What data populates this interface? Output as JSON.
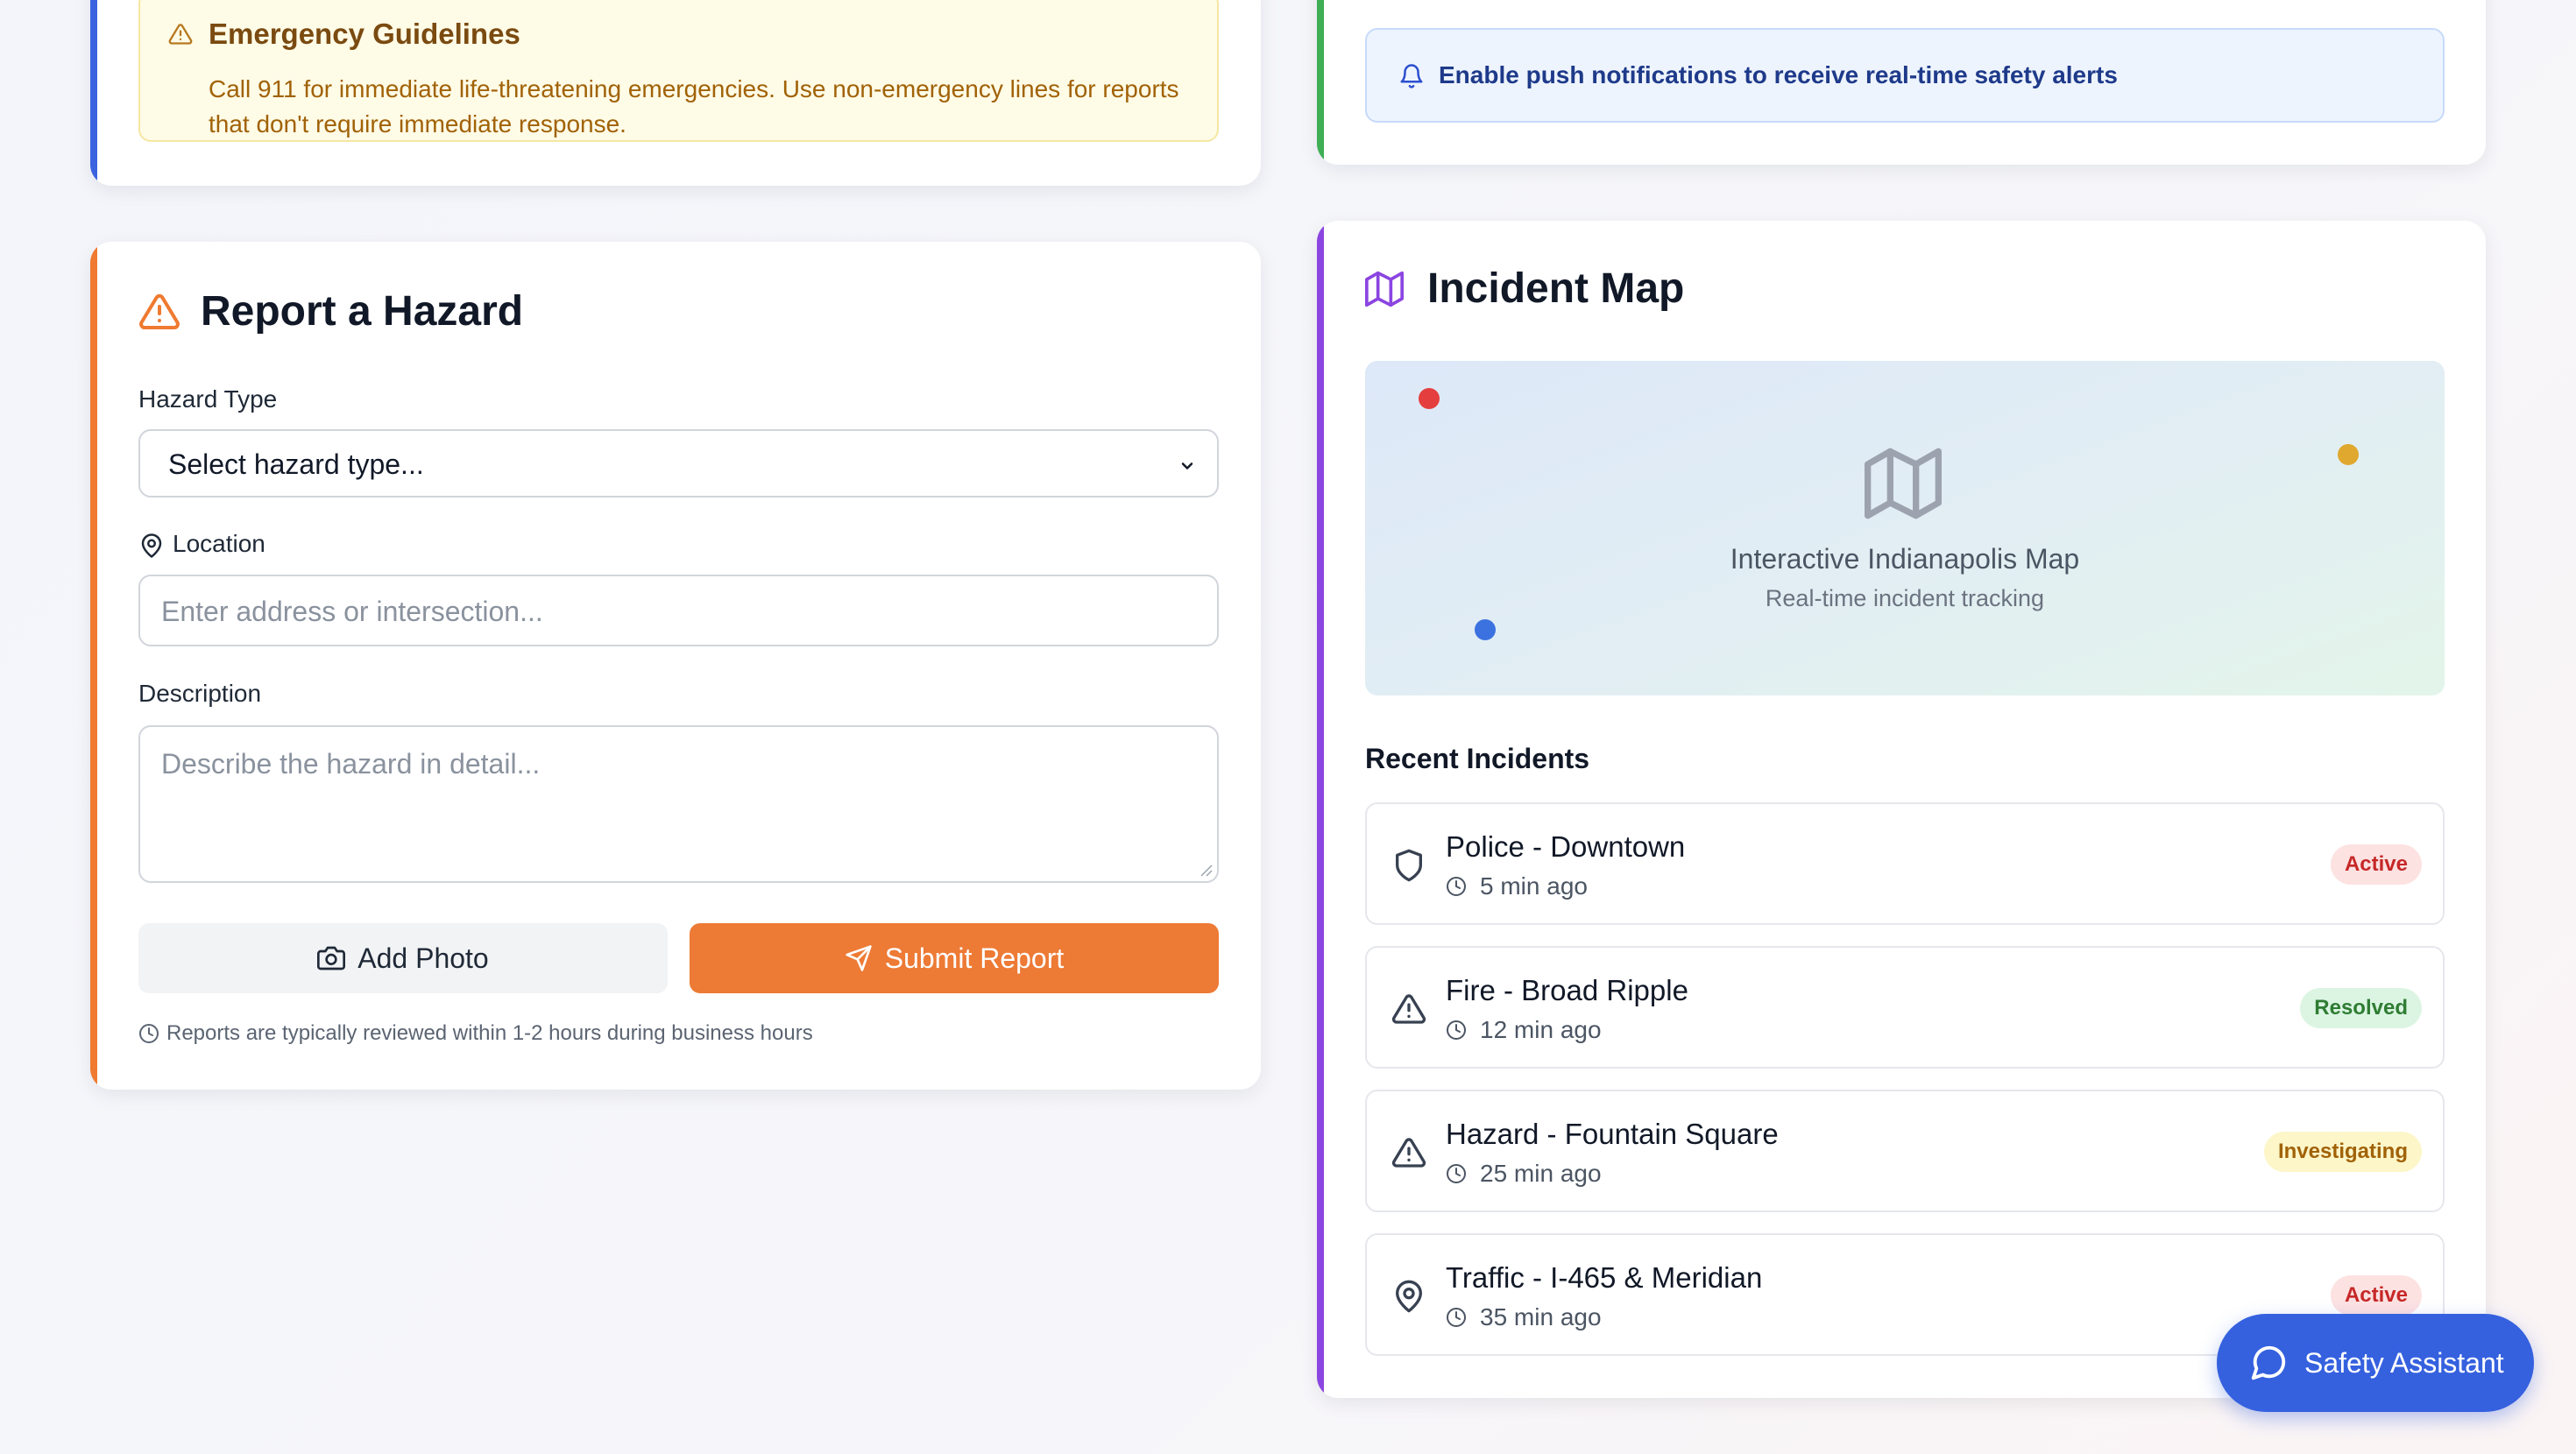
{
  "guidelines": {
    "title": "Emergency Guidelines",
    "text": "Call 911 for immediate life-threatening emergencies. Use non-emergency lines for reports that don't require immediate response.",
    "icon": "warning-icon"
  },
  "notifications": {
    "text": "Enable push notifications to receive real-time safety alerts",
    "icon": "bell-icon"
  },
  "hazard_form": {
    "title": "Report a Hazard",
    "title_icon": "warning-icon",
    "type_label": "Hazard Type",
    "type_value": "Select hazard type...",
    "location_label": "Location",
    "location_placeholder": "Enter address or intersection...",
    "description_label": "Description",
    "description_placeholder": "Describe the hazard in detail...",
    "add_photo_label": "Add Photo",
    "submit_label": "Submit Report",
    "review_note": "Reports are typically reviewed within 1-2 hours during business hours"
  },
  "incident_map": {
    "title": "Incident Map",
    "title_icon": "map-icon",
    "map_caption": "Interactive Indianapolis Map",
    "map_subcaption": "Real-time incident tracking",
    "recent_title": "Recent Incidents",
    "incidents": [
      {
        "name": "Police - Downtown",
        "time": "5 min ago",
        "status": "Active",
        "icon": "shield-icon"
      },
      {
        "name": "Fire - Broad Ripple",
        "time": "12 min ago",
        "status": "Resolved",
        "icon": "warning-icon"
      },
      {
        "name": "Hazard - Fountain Square",
        "time": "25 min ago",
        "status": "Investigating",
        "icon": "warning-icon"
      },
      {
        "name": "Traffic - I-465 & Meridian",
        "time": "35 min ago",
        "status": "Active",
        "icon": "map-pin-icon"
      }
    ]
  },
  "assistant": {
    "label": "Safety Assistant",
    "icon": "chat-icon"
  },
  "colors": {
    "accent_blue": "#3b63e0",
    "accent_green": "#3fae55",
    "accent_orange": "#ef7a30",
    "accent_purple": "#8b45e0",
    "status_active_bg": "#fde2e2",
    "status_active_fg": "#c62828",
    "status_resolved_bg": "#dcf5e3",
    "status_resolved_fg": "#2e7d32",
    "status_investigating_bg": "#fdf6c9",
    "status_investigating_fg": "#a16207"
  }
}
